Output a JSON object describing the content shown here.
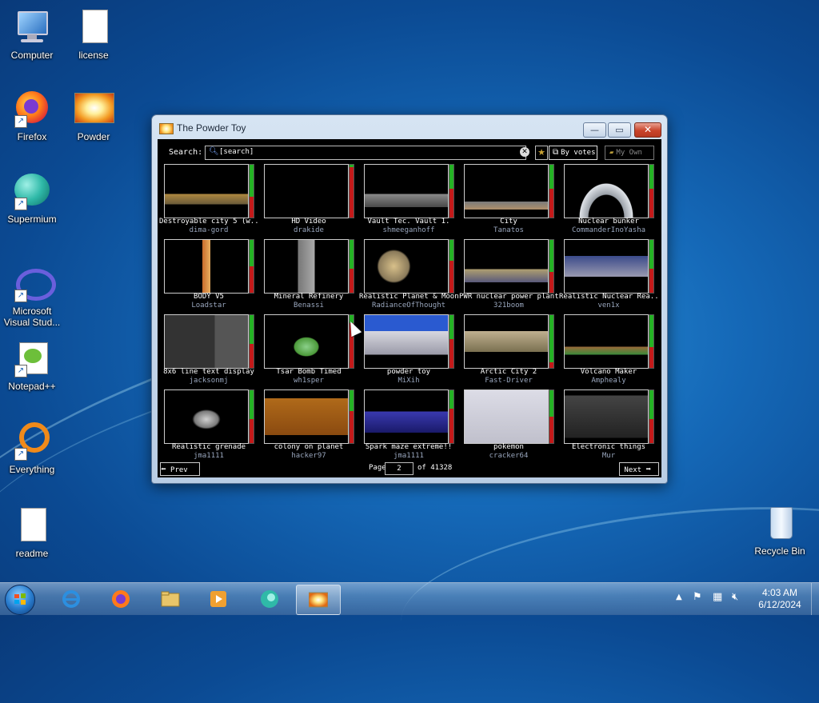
{
  "desktop": {
    "icons": [
      {
        "label": "Computer"
      },
      {
        "label": "license"
      },
      {
        "label": "Firefox"
      },
      {
        "label": "Powder"
      },
      {
        "label": "Supermium"
      },
      {
        "label": "Microsoft Visual Stud..."
      },
      {
        "label": "Notepad++"
      },
      {
        "label": "Everything"
      },
      {
        "label": "readme"
      },
      {
        "label": "Recycle Bin"
      }
    ]
  },
  "window": {
    "title": "The Powder Toy",
    "min_glyph": "—",
    "max_glyph": "▭",
    "close_glyph": "✕"
  },
  "search": {
    "label": "Search:",
    "value": "[search]",
    "clear_glyph": "✕",
    "fav_glyph": "★",
    "sort_label": "By votes",
    "own_label": "My Own"
  },
  "saves": [
    {
      "title": "Destroyable city 5 (w...",
      "author": "dima-gord",
      "up": 0.6,
      "down": 0.4
    },
    {
      "title": "HD Video",
      "author": "drakide",
      "up": 0.05,
      "down": 0.95
    },
    {
      "title": "Vault Tec. Vault 1.",
      "author": "shmeeganhoff",
      "up": 0.45,
      "down": 0.55
    },
    {
      "title": "City",
      "author": "Tanatos",
      "up": 0.45,
      "down": 0.55
    },
    {
      "title": "Nuclear bunker",
      "author": "CommanderInoYasha",
      "up": 0.45,
      "down": 0.55
    },
    {
      "title": "BODY V5",
      "author": "Loadstar",
      "up": 0.5,
      "down": 0.5
    },
    {
      "title": "Mineral Refinery",
      "author": "Benassi",
      "up": 0.55,
      "down": 0.45
    },
    {
      "title": "Realistic Planet & Moon",
      "author": "RadianceOfThought",
      "up": 0.4,
      "down": 0.6
    },
    {
      "title": "PWR nuclear power plant",
      "author": "321boom",
      "up": 0.6,
      "down": 0.4
    },
    {
      "title": "Realistic Nuclear Rea...",
      "author": "ven1x",
      "up": 0.55,
      "down": 0.45
    },
    {
      "title": "8x6 line text display",
      "author": "jacksonmj",
      "up": 0.55,
      "down": 0.45
    },
    {
      "title": "Tsar Bomb Timed",
      "author": "wh1sper",
      "up": 0.15,
      "down": 0.85
    },
    {
      "title": "powder toy",
      "author": "MiXih",
      "up": 0.45,
      "down": 0.55
    },
    {
      "title": "Arctic City 2",
      "author": "Fast-Driver",
      "up": 0.9,
      "down": 0.1
    },
    {
      "title": "Volcano Maker",
      "author": "Amphealy",
      "up": 0.6,
      "down": 0.4
    },
    {
      "title": "Realistic grenade",
      "author": "jma1111",
      "up": 0.55,
      "down": 0.45
    },
    {
      "title": "colony on planet",
      "author": "hacker97",
      "up": 0.4,
      "down": 0.6
    },
    {
      "title": "Spark maze extreme!!",
      "author": "jma1111",
      "up": 0.35,
      "down": 0.65
    },
    {
      "title": "pokemon",
      "author": "cracker64",
      "up": 0.5,
      "down": 0.5
    },
    {
      "title": "Electronic things",
      "author": "Mur",
      "up": 0.55,
      "down": 0.45
    }
  ],
  "pager": {
    "prev_label": "Prev",
    "next_label": "Next",
    "page_label": "Page",
    "page_value": "2",
    "of_label": "of 41328"
  },
  "taskbar": {
    "clock_time": "4:03 AM",
    "clock_date": "6/12/2024"
  }
}
